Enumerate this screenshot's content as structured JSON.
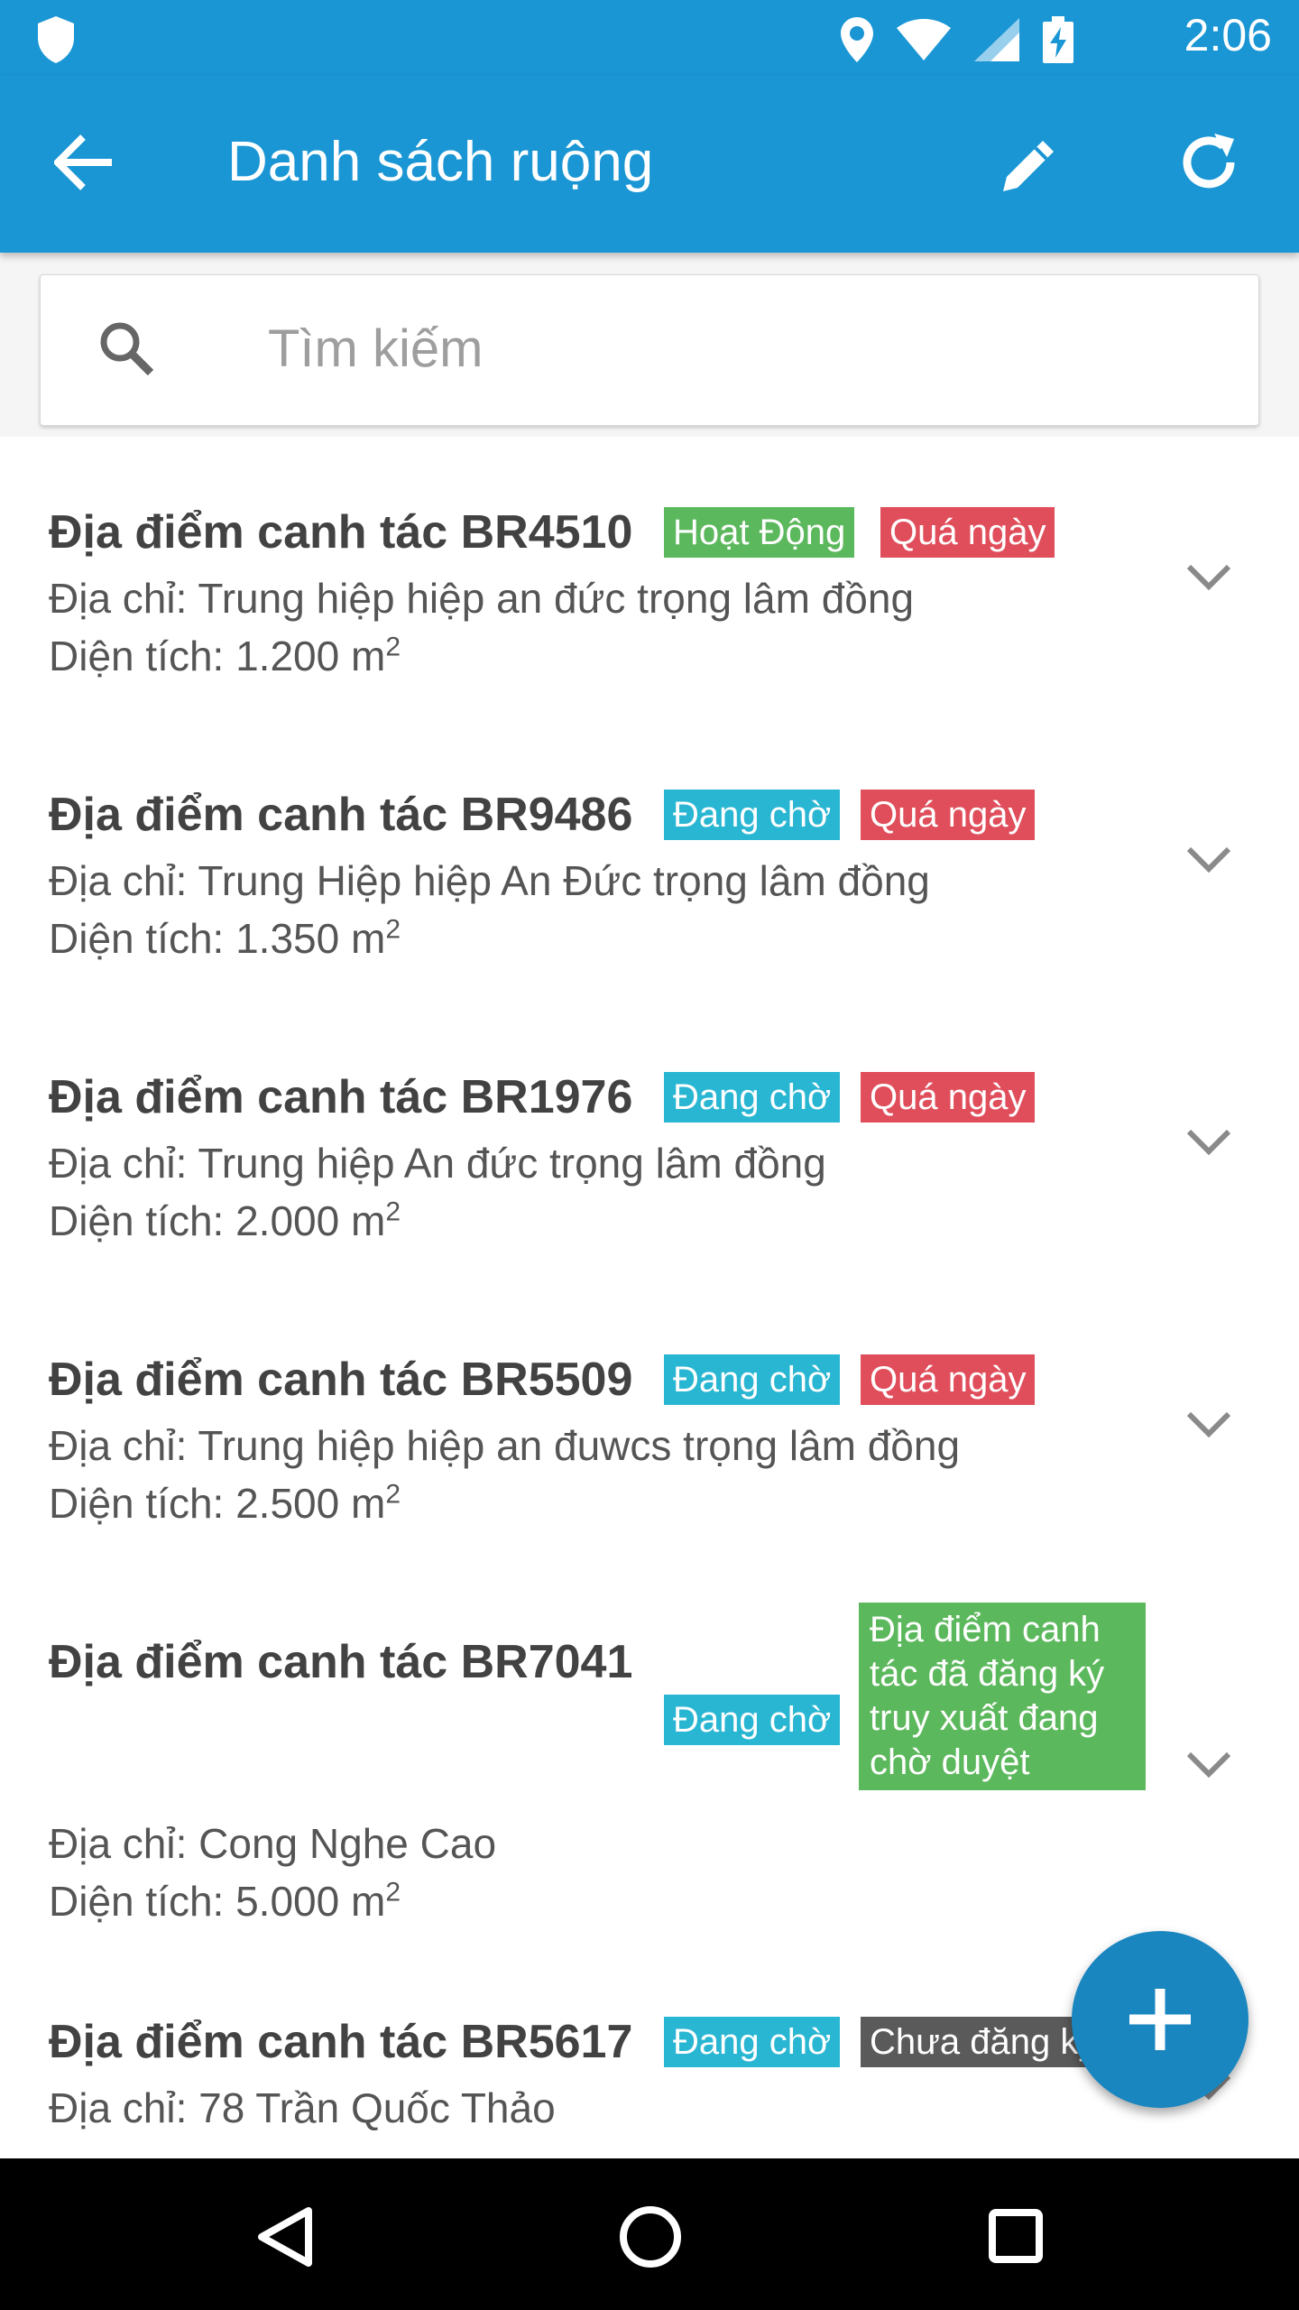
{
  "status_bar": {
    "time": "2:06",
    "icons": [
      "shield-icon",
      "location-icon",
      "wifi-icon",
      "signal-icon",
      "battery-charging-icon"
    ]
  },
  "app_bar": {
    "title": "Danh sách ruộng",
    "actions": [
      "back-arrow-icon",
      "edit-pencil-icon",
      "refresh-icon"
    ]
  },
  "search": {
    "placeholder": "Tìm kiếm",
    "value": ""
  },
  "fields": [
    {
      "name": "Địa điểm canh tác BR4510",
      "badges": [
        {
          "label": "Hoạt Động",
          "color": "#5cb85c"
        },
        {
          "label": "Quá ngày",
          "color": "#e04e5b"
        }
      ],
      "address": "Địa chỉ: Trung hiệp hiệp an đức trọng lâm đồng",
      "area_label": "Diện tích: 1.200 m",
      "area_unit_exp": "2"
    },
    {
      "name": "Địa điểm canh tác BR9486",
      "badges": [
        {
          "label": "Đang chờ",
          "color": "#29b6d2"
        },
        {
          "label": "Quá ngày",
          "color": "#e04e5b"
        }
      ],
      "address": "Địa chỉ: Trung Hiệp hiệp An Đức trọng lâm đồng",
      "area_label": "Diện tích: 1.350 m",
      "area_unit_exp": "2"
    },
    {
      "name": "Địa điểm canh tác BR1976",
      "badges": [
        {
          "label": "Đang chờ",
          "color": "#29b6d2"
        },
        {
          "label": "Quá ngày",
          "color": "#e04e5b"
        }
      ],
      "address": "Địa chỉ: Trung hiệp An đức trọng lâm đồng",
      "area_label": "Diện tích: 2.000 m",
      "area_unit_exp": "2"
    },
    {
      "name": "Địa điểm canh tác BR5509",
      "badges": [
        {
          "label": "Đang chờ",
          "color": "#29b6d2"
        },
        {
          "label": "Quá ngày",
          "color": "#e04e5b"
        }
      ],
      "address": "Địa chỉ: Trung hiệp hiệp an đuwcs trọng lâm đồng",
      "area_label": "Diện tích: 2.500 m",
      "area_unit_exp": "2"
    },
    {
      "name": "Địa điểm canh tác BR7041",
      "badges": [
        {
          "label": "Đang chờ",
          "color": "#29b6d2"
        },
        {
          "label": "Địa điểm canh tác đã đăng ký truy xuất đang chờ duyệt",
          "color": "#5cb85c"
        }
      ],
      "address": "Địa chỉ: Cong Nghe Cao",
      "area_label": "Diện tích: 5.000 m",
      "area_unit_exp": "2"
    },
    {
      "name": "Địa điểm canh tác BR5617",
      "badges": [
        {
          "label": "Đang chờ",
          "color": "#29b6d2"
        },
        {
          "label": "Chưa đăng ký",
          "color": "#5a5a5a"
        }
      ],
      "address": "Địa chỉ: 78 Trần Quốc Thảo"
    }
  ],
  "fab": {
    "icon": "plus-icon"
  },
  "nav_bar": {
    "icons": [
      "back-triangle-icon",
      "home-circle-icon",
      "recents-square-icon"
    ]
  }
}
